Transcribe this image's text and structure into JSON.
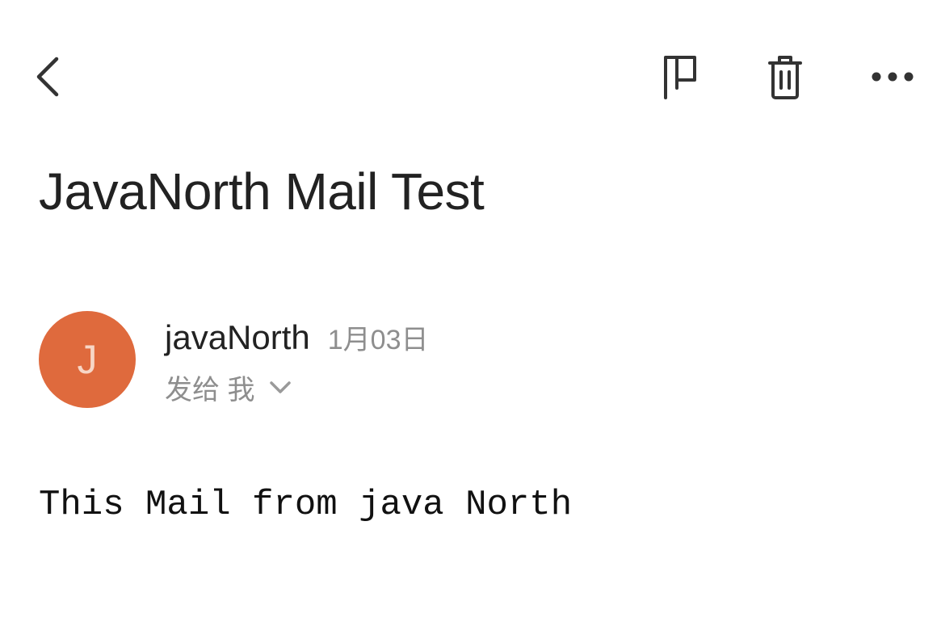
{
  "toolbar": {
    "back_icon": "chevron-left-icon",
    "flag_icon": "flag-icon",
    "trash_icon": "trash-icon",
    "more_icon": "more-horizontal-icon"
  },
  "message": {
    "subject": "JavaNorth Mail Test",
    "sender": {
      "avatar_letter": "J",
      "avatar_color": "#df6a3d",
      "name": "javaNorth",
      "date": "1月03日"
    },
    "recipient_label": "发给 我",
    "body": "This Mail from java North"
  }
}
